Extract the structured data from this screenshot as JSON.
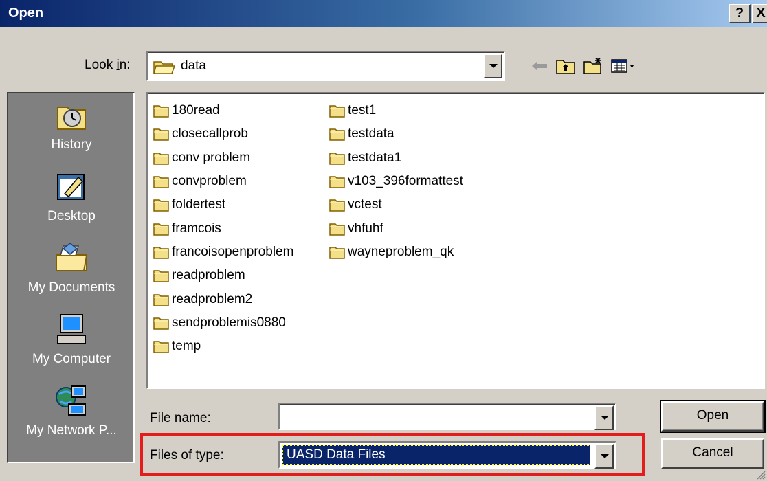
{
  "window": {
    "title": "Open",
    "help_button": "?",
    "close_button": "X"
  },
  "lookin": {
    "label": "Look in:",
    "value": "data"
  },
  "places": [
    {
      "label": "History",
      "icon": "history-icon"
    },
    {
      "label": "Desktop",
      "icon": "desktop-icon"
    },
    {
      "label": "My Documents",
      "icon": "my-documents-icon"
    },
    {
      "label": "My Computer",
      "icon": "my-computer-icon"
    },
    {
      "label": "My Network P...",
      "icon": "my-network-places-icon"
    }
  ],
  "files": {
    "column1": [
      "180read",
      "closecallprob",
      "conv problem",
      "convproblem",
      "foldertest",
      "framcois",
      "francoisopenproblem",
      "readproblem",
      "readproblem2",
      "sendproblemis0880",
      "temp"
    ],
    "column2": [
      "test1",
      "testdata",
      "testdata1",
      "v103_396formattest",
      "vctest",
      "vhfuhf",
      "wayneproblem_qk"
    ]
  },
  "file_name": {
    "label": "File name:",
    "value": ""
  },
  "file_type": {
    "label": "Files of type:",
    "value": "UASD Data Files"
  },
  "buttons": {
    "open": "Open",
    "cancel": "Cancel"
  },
  "colors": {
    "title_bar": "#0a246a",
    "highlight_box": "#e41c1c",
    "dialog_bg": "#d4d0c8"
  }
}
